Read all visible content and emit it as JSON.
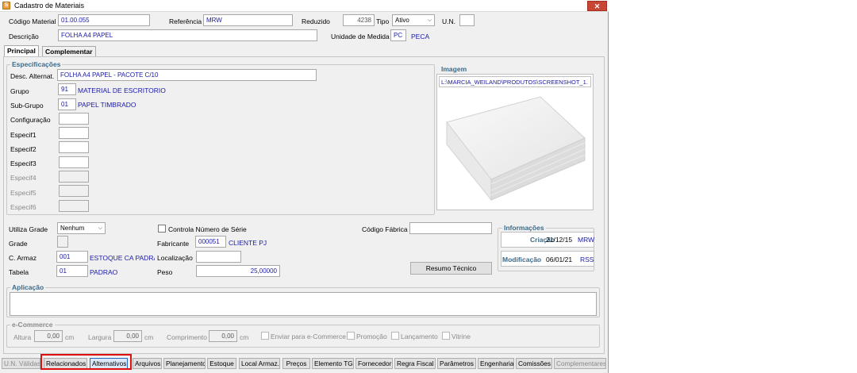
{
  "window": {
    "title": "Cadastro de Materiais",
    "close": "✕",
    "icon_glyph": "S"
  },
  "header": {
    "codigo_label": "Código Material",
    "codigo_value": "01.00.055",
    "referencia_label": "Referência",
    "referencia_value": "MRW",
    "reduzido_label": "Reduzido",
    "reduzido_value": "4238",
    "tipo_label": "Tipo",
    "tipo_value": "Ativo",
    "un_label": "U.N.",
    "un_value": "",
    "descricao_label": "Descrição",
    "descricao_value": "FOLHA A4 PAPEL",
    "unidade_label": "Unidade de Medida",
    "unidade_code": "PC",
    "unidade_name": "PECA"
  },
  "tabs": [
    {
      "label": "Principal"
    },
    {
      "label": "Complementar"
    }
  ],
  "especificacoes": {
    "title": "Especificações",
    "desc_alt_label": "Desc. Alternat.",
    "desc_alt_value": "FOLHA A4 PAPEL - PACOTE C/10",
    "grupo_label": "Grupo",
    "grupo_code": "91",
    "grupo_name": "MATERIAL DE ESCRITORIO",
    "subgrupo_label": "Sub-Grupo",
    "subgrupo_code": "01",
    "subgrupo_name": "PAPEL TIMBRADO",
    "config_label": "Configuração",
    "especif": [
      "Especif1",
      "Especif2",
      "Especif3",
      "Especif4",
      "Especif5",
      "Especif6"
    ]
  },
  "imagem": {
    "title": "Imagem",
    "path": "L:\\MARCIA_WEILAND\\PRODUTOS\\SCREENSHOT_1."
  },
  "detalhes": {
    "utiliza_grade_label": "Utiliza Grade",
    "utiliza_grade_value": "Nenhum",
    "grade_label": "Grade",
    "carmaz_label": "C. Armaz",
    "carmaz_code": "001",
    "carmaz_name": "ESTOQUE CA PADRAO",
    "tabela_label": "Tabela",
    "tabela_code": "01",
    "tabela_name": "PADRAO",
    "controla_label": "Controla Número de Série",
    "fabricante_label": "Fabricante",
    "fabricante_code": "000051",
    "fabricante_name": "CLIENTE PJ",
    "localizacao_label": "Localização",
    "peso_label": "Peso",
    "peso_value": "25,00000",
    "codigo_fabrica_label": "Código Fábrica",
    "resumo_button": "Resumo Técnico"
  },
  "informacoes": {
    "title": "Informações",
    "criacao_label": "Criação",
    "criacao_date": "21/12/15",
    "criacao_user": "MRW",
    "modificacao_label": "Modificação",
    "modificacao_date": "06/01/21",
    "modificacao_user": "RSS"
  },
  "aplicacao": {
    "title": "Aplicação"
  },
  "ecommerce": {
    "title": "e-Commerce",
    "altura_label": "Altura",
    "altura_value": "0,00",
    "altura_unit": "cm",
    "largura_label": "Largura",
    "largura_value": "0,00",
    "largura_unit": "cm",
    "comprimento_label": "Comprimento",
    "comprimento_value": "0,00",
    "comprimento_unit": "cm",
    "enviar_label": "Enviar para e-Commerce",
    "promocao_label": "Promoção",
    "lancamento_label": "Lançamento",
    "vitrine_label": "Vitrine"
  },
  "bottom_buttons": [
    {
      "label": "U.N. Válidas"
    },
    {
      "label": "Relacionados"
    },
    {
      "label": "Alternativos"
    },
    {
      "label": "Arquivos"
    },
    {
      "label": "Planejamento"
    },
    {
      "label": "Estoque"
    },
    {
      "label": "Local Armaz."
    },
    {
      "label": "Preços"
    },
    {
      "label": "Elemento TG"
    },
    {
      "label": "Fornecedor"
    },
    {
      "label": "Regra Fiscal"
    },
    {
      "label": "Parâmetros"
    },
    {
      "label": "Engenharia"
    },
    {
      "label": "Comissões"
    },
    {
      "label": "Complementares"
    }
  ],
  "colors": {
    "accent": "#3b6a8a",
    "value_text": "#1a1aa6",
    "highlight": "#e01010",
    "close": "#c94536"
  }
}
